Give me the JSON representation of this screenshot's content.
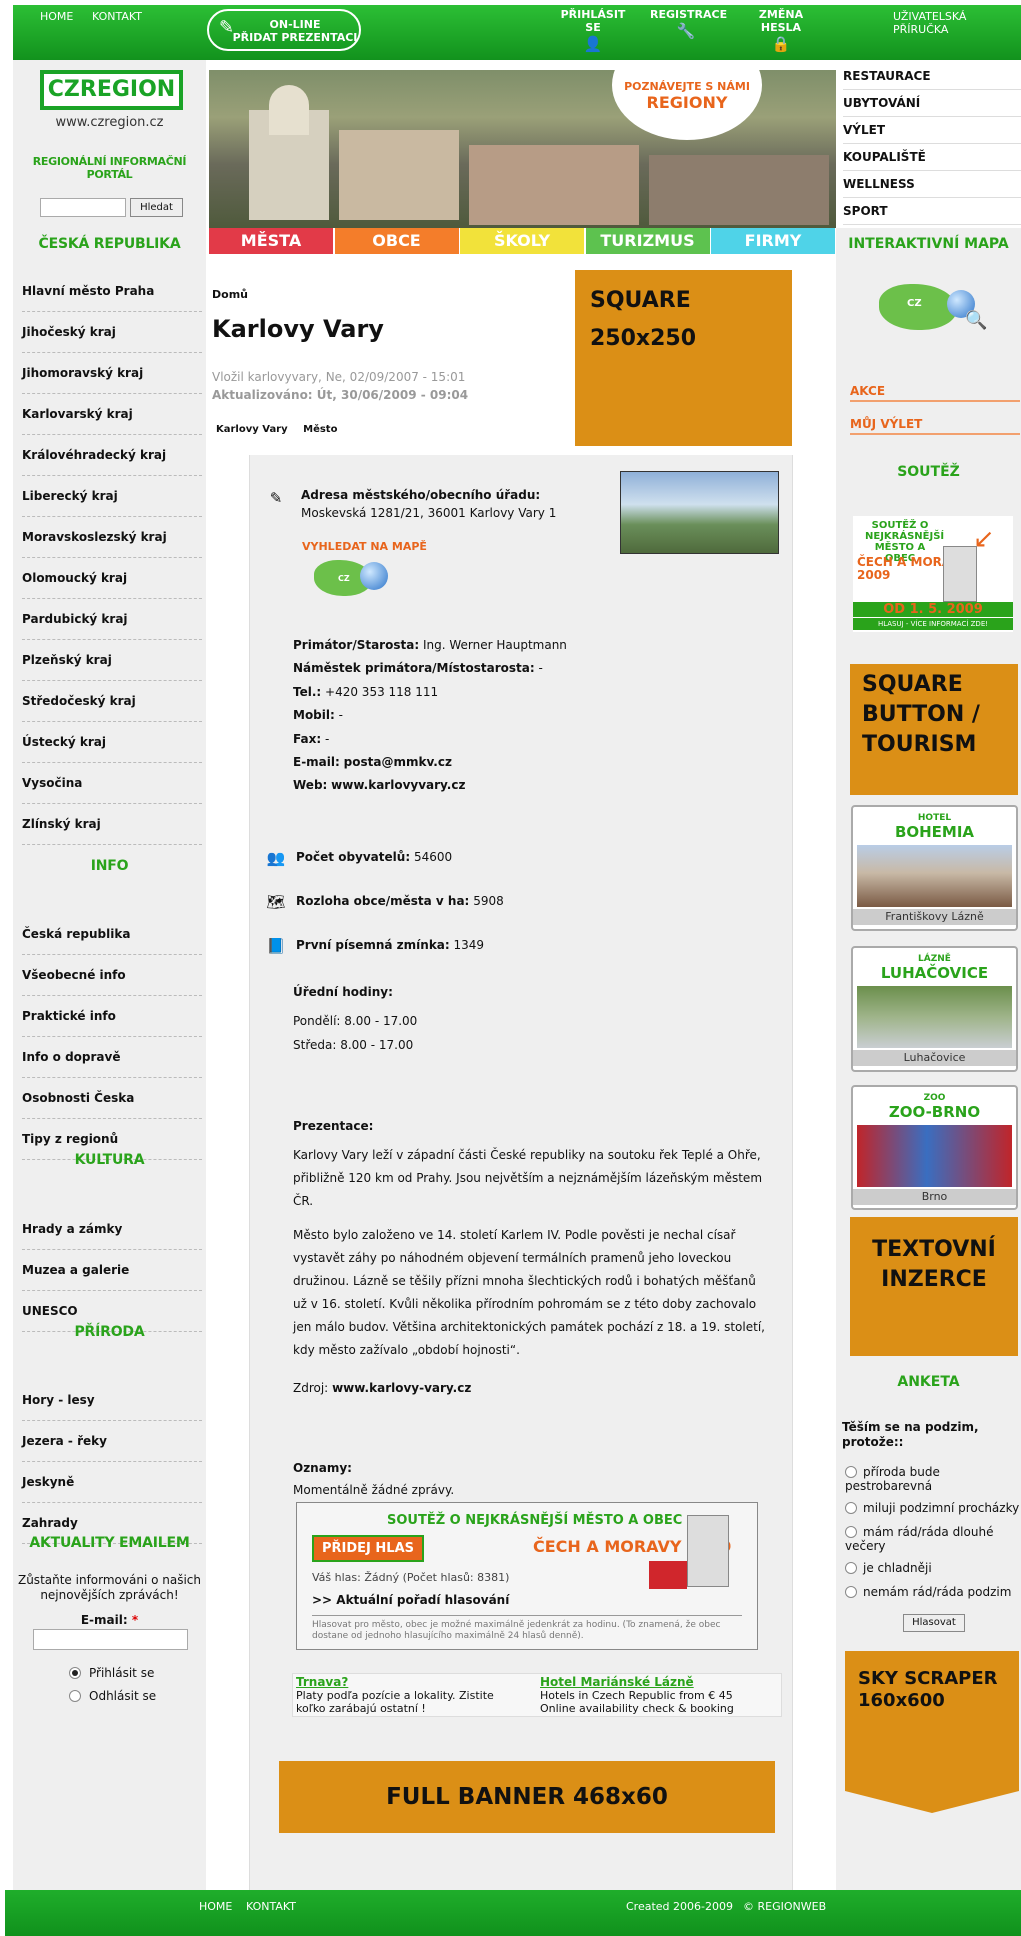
{
  "topbar": {
    "home": "HOME",
    "contact": "KONTAKT",
    "add_presentation_line1": "ON-LINE",
    "add_presentation_line2": "PŘIDAT PREZENTACI",
    "login": "PŘIHLÁSIT SE",
    "register": "REGISTRACE",
    "change_password": "ZMĚNA HESLA",
    "user_guide": "UŽIVATELSKÁ  PŘÍRUČKA"
  },
  "logo": {
    "text": "CZREGION",
    "url": "www.czregion.cz",
    "portal": "REGIONÁLNÍ INFORMAČNÍ PORTÁL"
  },
  "search": {
    "value": "",
    "button": "Hledat"
  },
  "hero": {
    "line1": "POZNÁVEJTE S NÁMI",
    "line2": "REGIONY"
  },
  "tabs": [
    {
      "label": "MĚSTA",
      "color": "#e23a48"
    },
    {
      "label": "OBCE",
      "color": "#f47d2a"
    },
    {
      "label": "ŠKOLY",
      "color": "#f2e23a"
    },
    {
      "label": "TURIZMUS",
      "color": "#5dc24f"
    },
    {
      "label": "FIRMY",
      "color": "#4fd3e8"
    }
  ],
  "right_menu": [
    "RESTAURACE",
    "UBYTOVÁNÍ",
    "VÝLET",
    "KOUPALIŠTĚ",
    "WELLNESS",
    "SPORT"
  ],
  "left": {
    "section1": "ČESKÁ REPUBLIKA",
    "regions": [
      "Hlavní město Praha",
      "Jihočeský kraj",
      "Jihomoravský kraj",
      "Karlovarský kraj",
      "Královéhradecký kraj",
      "Liberecký kraj",
      "Moravskoslezský kraj",
      "Olomoucký kraj",
      "Pardubický kraj",
      "Plzeňský kraj",
      "Středočeský kraj",
      "Ústecký kraj",
      "Vysočina",
      "Zlínský kraj"
    ],
    "section2": "INFO",
    "info": [
      "Česká republika",
      "Všeobecné info",
      "Praktické info",
      "Info o dopravě",
      "Osobnosti Česka",
      "Tipy z regionů"
    ],
    "section3": "KULTURA",
    "culture": [
      "Hrady a zámky",
      "Muzea a galerie",
      "UNESCO"
    ],
    "section4": "PŘÍRODA",
    "nature": [
      "Hory - lesy",
      "Jezera - řeky",
      "Jeskyně",
      "Zahrady"
    ],
    "section5": "AKTUALITY EMAILEM",
    "newsletter_text": "Zůstaňte informováni o našich nejnovějších zprávách!",
    "email_label": "E-mail:",
    "required_mark": "*",
    "email_value": "",
    "subscribe": "Přihlásit se",
    "unsubscribe": "Odhlásit se"
  },
  "main": {
    "breadcrumb": "Domů",
    "title": "Karlovy Vary",
    "posted": "Vložil karlovyvary, Ne, 02/09/2007 - 15:01",
    "updated": "Aktualizováno: Út, 30/06/2009 - 09:04",
    "tags": [
      "Karlovy Vary",
      "Město"
    ],
    "ad_square": "SQUARE 250x250",
    "address_label": "Adresa městského/obecního úřadu:",
    "address": "Moskevská 1281/21, 36001 Karlovy Vary 1",
    "map_link": "VYHLEDAT NA MAPĚ",
    "map_badge": "CZ",
    "mayor_label": "Primátor/Starosta:",
    "mayor": "Ing. Werner Hauptmann",
    "deputy_label": "Náměstek primátora/Místostarosta:",
    "deputy": "-",
    "tel_label": "Tel.:",
    "tel": "+420 353 118 111",
    "mobile_label": "Mobil:",
    "mobile": "-",
    "fax_label": "Fax:",
    "fax": "-",
    "email_label": "E-mail:",
    "email": "posta@mmkv.cz",
    "web_label": "Web:",
    "web": "www.karlovyvary.cz",
    "population_label": "Počet obyvatelů:",
    "population": "54600",
    "area_label": "Rozloha obce/města v ha:",
    "area": "5908",
    "first_mention_label": "První písemná zmínka:",
    "first_mention": "1349",
    "hours_label": "Úřední hodiny:",
    "hours1": "Pondělí: 8.00 - 17.00",
    "hours2": "Středa: 8.00 - 17.00",
    "presentation_label": "Prezentace:",
    "presentation_p1": "Karlovy Vary leží v západní části České republiky na soutoku řek Teplé a Ohře, přibližně 120 km od Prahy. Jsou největším a nejznámějším lázeňským městem ČR.",
    "presentation_p2": "Město bylo založeno ve 14. století Karlem IV. Podle pověsti je nechal císař vystavět záhy po náhodném objevení termálních pramenů jeho loveckou družinou. Lázně se těšily přízni mnoha šlechtických rodů i bohatých měšťanů už v 16. století. Kvůli několika přírodním pohromám se z této doby zachovalo jen málo budov. Většina architektonických památek pochází z 18. a 19. století, kdy město zažívalo „období hojnosti“.",
    "source_label": "Zdroj:",
    "source": "www.karlovy-vary.cz",
    "notices_label": "Oznamy:",
    "notices": "Momentálně žádné zprávy.",
    "contest_heading": "SOUTĚŽ O NEJKRÁSNĚJŠÍ MĚSTO A  OBEC",
    "contest_heading2": "ČECH A MORAVY 2009",
    "vote_button": "PŘIDEJ HLAS",
    "your_vote": "Váš hlas: Žádný (Počet hlasů: 8381)",
    "current_order": ">> Aktuální pořadí hlasování",
    "vote_note": "Hlasovat pro město, obec je možné maximálně jedenkrát za hodinu. (To znamená, že obec dostane od jednoho hlasujícího maximálně 24 hlasů denně).",
    "ad1_title": "Trnava?",
    "ad1_text": "Platy podľa pozície a lokality. Zistite koľko zarábajú ostatní !",
    "ad2_title": "Hotel Mariánské Lázně",
    "ad2_text": "Hotels in Czech Republic from € 45 Online availability check & booking",
    "full_banner": "FULL BANNER  468x60"
  },
  "right": {
    "map_heading": "INTERAKTIVNÍ MAPA",
    "map_badge": "CZ",
    "akce": "AKCE",
    "trip": "MŮJ VÝLET",
    "contest_heading": "SOUTĚŽ",
    "contest_l1": "SOUTĚŽ O",
    "contest_l2": "NEJKRÁSNĚJŠÍ",
    "contest_l3": "MĚSTO A OBEC",
    "contest_l4": "ČECH A MORAVY",
    "contest_l5": "2009",
    "contest_date": "OD 1. 5. 2009",
    "contest_note": "HLASUJ - VÍCE INFORMACÍ ZDE!",
    "square_button": "SQUARE BUTTON / TOURISM",
    "hotel1_small": "HOTEL",
    "hotel1_name": "BOHEMIA",
    "hotel1_caption": "Františkovy Lázně",
    "hotel2_small": "LÁZNĚ",
    "hotel2_name": "LUHAČOVICE",
    "hotel2_caption": "Luhačovice",
    "hotel3_small": "ZOO",
    "hotel3_name": "ZOO-BRNO",
    "hotel3_caption": "Brno",
    "text_ad": "TEXTOVNÍ INZERCE",
    "poll_heading": "ANKETA",
    "poll_question": "Těším se na podzim, protože::",
    "poll_options": [
      "příroda bude pestrobarevná",
      "miluji podzimní procházky",
      "mám rád/ráda dlouhé večery",
      "je chladněji",
      "nemám rád/ráda podzim"
    ],
    "poll_button": "Hlasovat",
    "skyscraper": "SKY SCRAPER 160x600"
  },
  "footer": {
    "home": "HOME",
    "contact": "KONTAKT",
    "created": "Created 2006-2009",
    "copyright": "© REGIONWEB"
  }
}
